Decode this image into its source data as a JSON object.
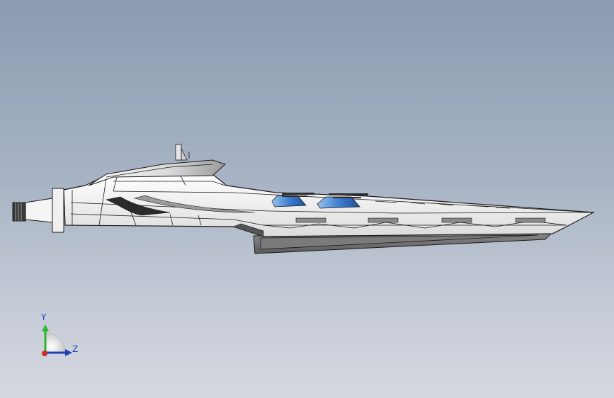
{
  "viewport": {
    "background_top": "#8a9bb0",
    "background_bottom": "#d4d8e0"
  },
  "model": {
    "hull_color": "#f4f4f4",
    "hull_shade": "#c9c9c9",
    "outline_color": "#1a1a1a",
    "keel_color": "#6e6e6e",
    "turret_color": "#3d7fd1"
  },
  "triad": {
    "y_label": "Y",
    "z_label": "Z",
    "y_color": "#2fb52f",
    "z_color": "#1f3fb8",
    "x_color": "#d42a2a"
  }
}
